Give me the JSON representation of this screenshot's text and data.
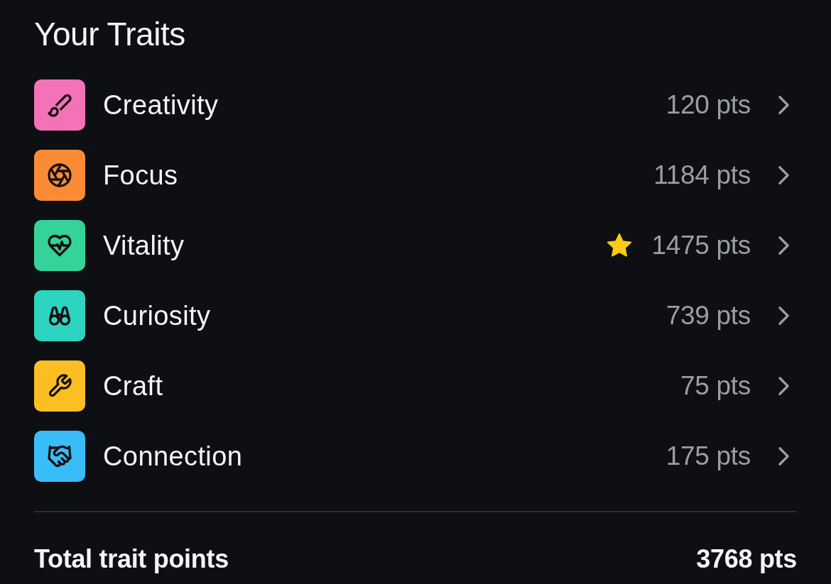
{
  "title": "Your Traits",
  "traits": [
    {
      "name": "Creativity",
      "points": "120 pts",
      "color": "#f472b6",
      "starred": false
    },
    {
      "name": "Focus",
      "points": "1184 pts",
      "color": "#fb8c35",
      "starred": false
    },
    {
      "name": "Vitality",
      "points": "1475 pts",
      "color": "#34d399",
      "starred": true
    },
    {
      "name": "Curiosity",
      "points": "739 pts",
      "color": "#2dd4bf",
      "starred": false
    },
    {
      "name": "Craft",
      "points": "75 pts",
      "color": "#fbbf24",
      "starred": false
    },
    {
      "name": "Connection",
      "points": "175 pts",
      "color": "#38bdf8",
      "starred": false
    }
  ],
  "total": {
    "label": "Total trait points",
    "value": "3768 pts"
  }
}
